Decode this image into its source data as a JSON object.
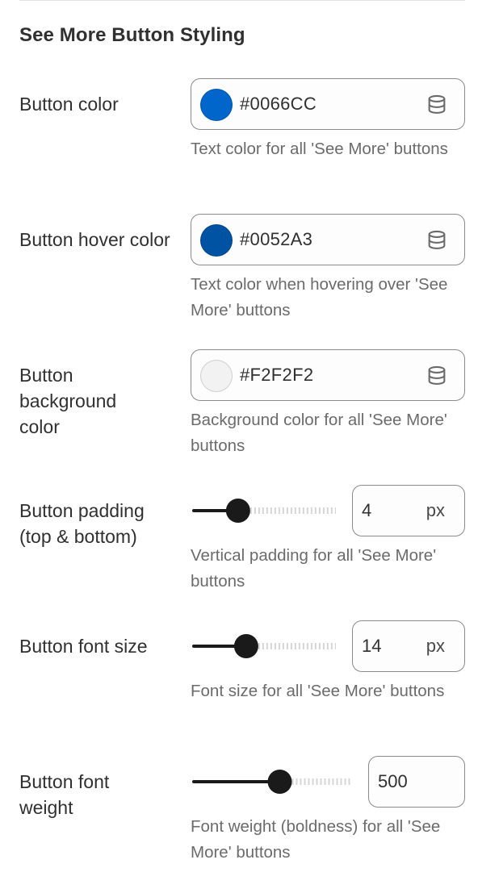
{
  "section": {
    "title": "See More Button Styling"
  },
  "color_settings": [
    {
      "label": "Button color",
      "value": "#0066CC",
      "swatch": "#0066CC",
      "help": "Text color for all 'See More' buttons",
      "icon": "database-icon"
    },
    {
      "label": "Button hover color",
      "value": "#0052A3",
      "swatch": "#0052A3",
      "help": "Text color when hovering over 'See More' buttons",
      "icon": "database-icon"
    },
    {
      "label": "Button background color",
      "value": "#F2F2F2",
      "swatch": "#F2F2F2",
      "help": "Background color for all 'See More' buttons",
      "icon": "database-icon"
    }
  ],
  "range_settings": [
    {
      "label": "Button padding (top & bottom)",
      "value": "4",
      "unit": "px",
      "fill_fraction": 0.25,
      "help": "Vertical padding for all 'See More' buttons"
    },
    {
      "label": "Button font size",
      "value": "14",
      "unit": "px",
      "fill_fraction": 0.31,
      "help": "Font size for all 'See More' buttons"
    },
    {
      "label": "Button font weight",
      "value": "500",
      "unit": "",
      "fill_fraction": 0.5,
      "help": "Font weight (boldness) for all 'See More' buttons"
    }
  ],
  "colors": {
    "track_active": "#1a1a1a",
    "track_inactive": "#d6d6d6",
    "thumb": "#1a1a1a"
  }
}
